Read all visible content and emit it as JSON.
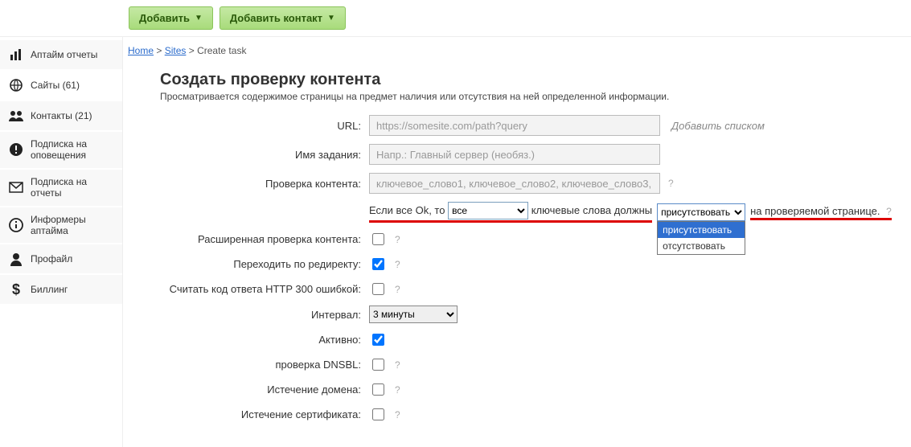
{
  "topbar": {
    "add_label": "Добавить",
    "add_contact_label": "Добавить контакт"
  },
  "breadcrumb": {
    "home": "Home",
    "sites": "Sites",
    "current": "Create task"
  },
  "sidebar": {
    "items": [
      {
        "label": "Аптайм отчеты"
      },
      {
        "label": "Сайты (61)"
      },
      {
        "label": "Контакты (21)"
      },
      {
        "label": "Подписка на оповещения"
      },
      {
        "label": "Подписка на отчеты"
      },
      {
        "label": "Информеры аптайма"
      },
      {
        "label": "Профайл"
      },
      {
        "label": "Биллинг"
      }
    ]
  },
  "page": {
    "title": "Создать проверку контента",
    "desc": "Просматривается содержимое страницы на предмет наличия или отсутствия на ней определенной информации."
  },
  "form": {
    "url_label": "URL:",
    "url_placeholder": "https://somesite.com/path?query",
    "url_addlist": "Добавить списком",
    "name_label": "Имя задания:",
    "name_placeholder": "Напр.: Главный сервер (необяз.)",
    "content_label": "Проверка контента:",
    "content_placeholder": "ключевое_слово1, ключевое_слово2, ключевое_слово3, ...",
    "sentence_pre": "Если все Ok, то",
    "sentence_select1": "все",
    "sentence_mid": "ключевые слова должны",
    "sentence_select2": "присутствовать",
    "sentence_post": "на проверяемой странице.",
    "presence_options": [
      "присутствовать",
      "отсутствовать"
    ],
    "ext_label": "Расширенная проверка контента:",
    "redirect_label": "Переходить по редиректу:",
    "http300_label": "Считать код ответа HTTP 300 ошибкой:",
    "interval_label": "Интервал:",
    "interval_value": "3 минуты",
    "active_label": "Активно:",
    "dnsbl_label": "проверка DNSBL:",
    "domain_exp_label": "Истечение домена:",
    "cert_exp_label": "Истечение сертификата:",
    "qmark": "?"
  }
}
